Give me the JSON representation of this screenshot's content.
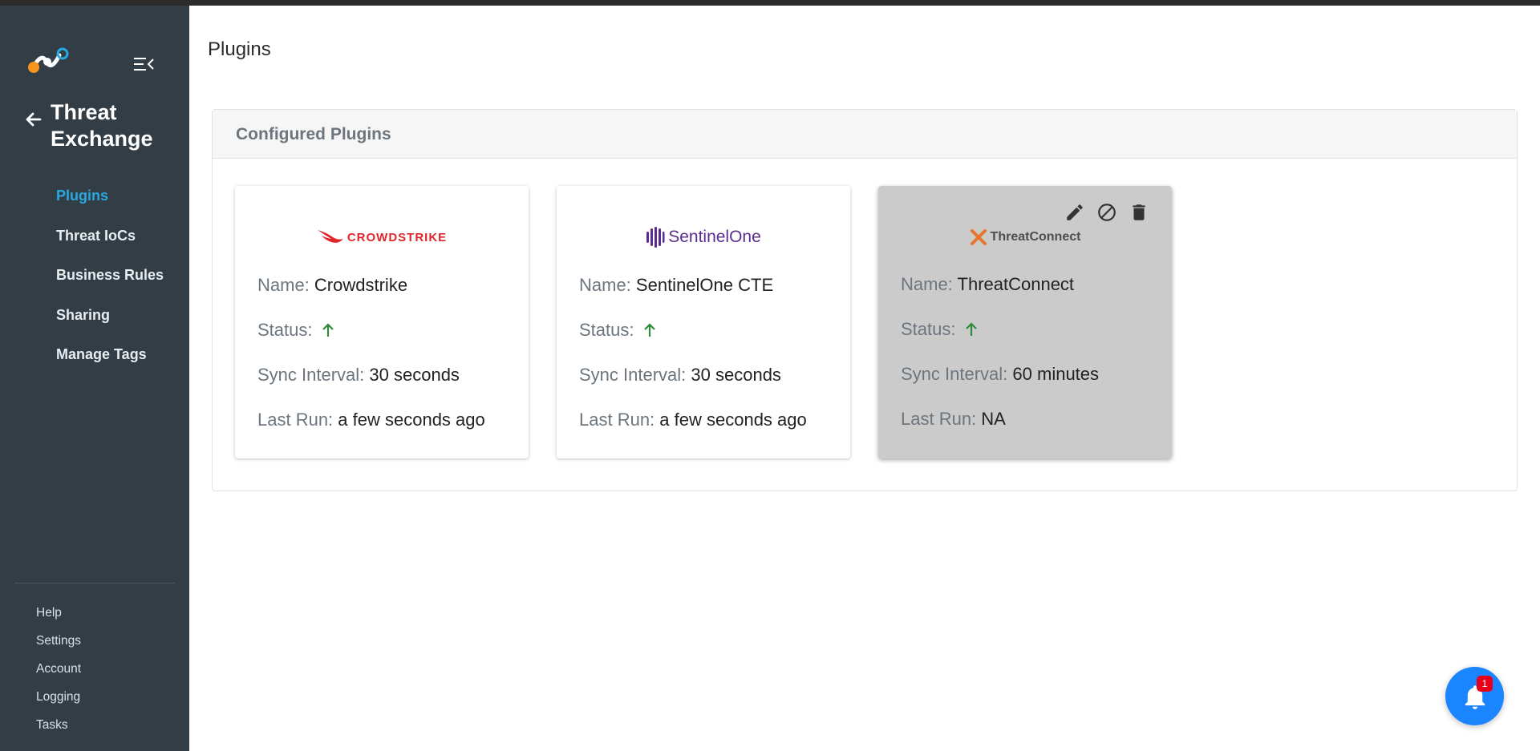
{
  "sidebar": {
    "section_title_line1": "Threat",
    "section_title_line2": "Exchange",
    "nav": [
      {
        "label": "Plugins",
        "active": true
      },
      {
        "label": "Threat IoCs"
      },
      {
        "label": "Business Rules"
      },
      {
        "label": "Sharing"
      },
      {
        "label": "Manage Tags"
      }
    ],
    "footer": [
      "Help",
      "Settings",
      "Account",
      "Logging",
      "Tasks"
    ]
  },
  "page": {
    "title": "Plugins",
    "panel_title": "Configured Plugins"
  },
  "labels": {
    "name": "Name:",
    "status": "Status:",
    "sync": "Sync Interval:",
    "last_run": "Last Run:"
  },
  "plugins": [
    {
      "logo_text": "CROWDSTRIKE",
      "name": "Crowdstrike",
      "status": "up",
      "sync_interval": "30 seconds",
      "last_run": "a few seconds ago"
    },
    {
      "logo_text": "SentinelOne",
      "name": "SentinelOne CTE",
      "status": "up",
      "sync_interval": "30 seconds",
      "last_run": "a few seconds ago"
    },
    {
      "logo_text": "ThreatConnect",
      "name": "ThreatConnect",
      "status": "up",
      "sync_interval": "60 minutes",
      "last_run": "NA"
    }
  ],
  "notifications": {
    "count": "1"
  },
  "colors": {
    "sidebar_bg": "#323d45",
    "active_nav": "#29a9e1",
    "status_up": "#2e8b3a",
    "crowdstrike": "#e0262b",
    "sentinelone": "#5b2d8e",
    "threatconnect": "#e8762c",
    "bell": "#1a85ff"
  }
}
